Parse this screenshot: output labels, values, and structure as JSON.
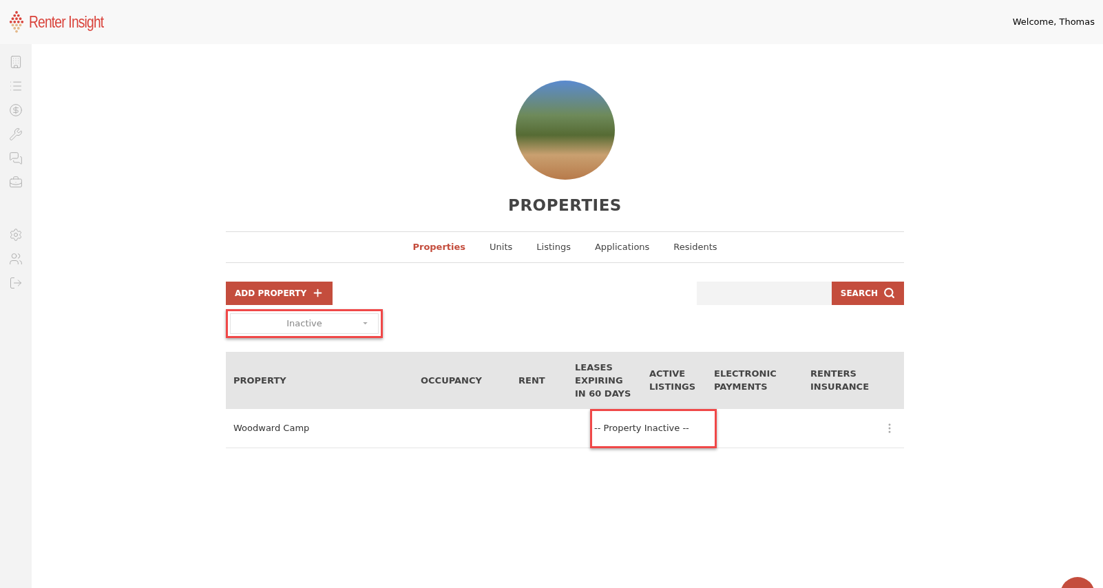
{
  "header": {
    "logo_text": "Renter Insight",
    "welcome": "Welcome, Thomas"
  },
  "page": {
    "title": "PROPERTIES"
  },
  "tabs": [
    {
      "label": "Properties",
      "selected": true
    },
    {
      "label": "Units",
      "selected": false
    },
    {
      "label": "Listings",
      "selected": false
    },
    {
      "label": "Applications",
      "selected": false
    },
    {
      "label": "Residents",
      "selected": false
    }
  ],
  "toolbar": {
    "add_button": "ADD PROPERTY",
    "search_button": "SEARCH",
    "status_filter": {
      "value": "Inactive",
      "highlighted": true
    }
  },
  "table": {
    "columns": [
      "PROPERTY",
      "OCCUPANCY",
      "RENT",
      "LEASES EXPIRING IN 60 DAYS",
      "ACTIVE LISTINGS",
      "ELECTRONIC PAYMENTS",
      "RENTERS INSURANCE"
    ],
    "rows": [
      {
        "property": "Woodward Camp",
        "status_note": "-- Property Inactive --",
        "highlighted": true
      }
    ]
  }
}
